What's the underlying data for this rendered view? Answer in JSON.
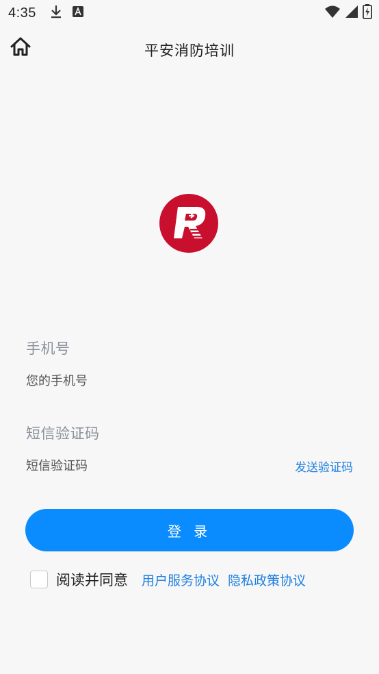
{
  "status_bar": {
    "time": "4:35",
    "left_icons": [
      "download-icon",
      "app-a-icon"
    ],
    "right_icons": [
      "wifi-icon",
      "signal-icon",
      "battery-charging-icon"
    ]
  },
  "header": {
    "title": "平安消防培训",
    "home_icon": "home-icon"
  },
  "logo": {
    "letter": "R",
    "brand_color": "#c8102e"
  },
  "form": {
    "phone": {
      "label": "手机号",
      "placeholder": "您的手机号",
      "value": ""
    },
    "sms": {
      "label": "短信验证码",
      "placeholder": "短信验证码",
      "value": "",
      "send_code_label": "发送验证码"
    },
    "login_label": "登 录",
    "agreement": {
      "checked": false,
      "text": "阅读并同意",
      "user_agreement": "用户服务协议",
      "privacy_policy": "隐私政策协议"
    }
  },
  "colors": {
    "accent": "#0a8cff",
    "link": "#1e7fe0",
    "background": "#f7f7f7"
  }
}
